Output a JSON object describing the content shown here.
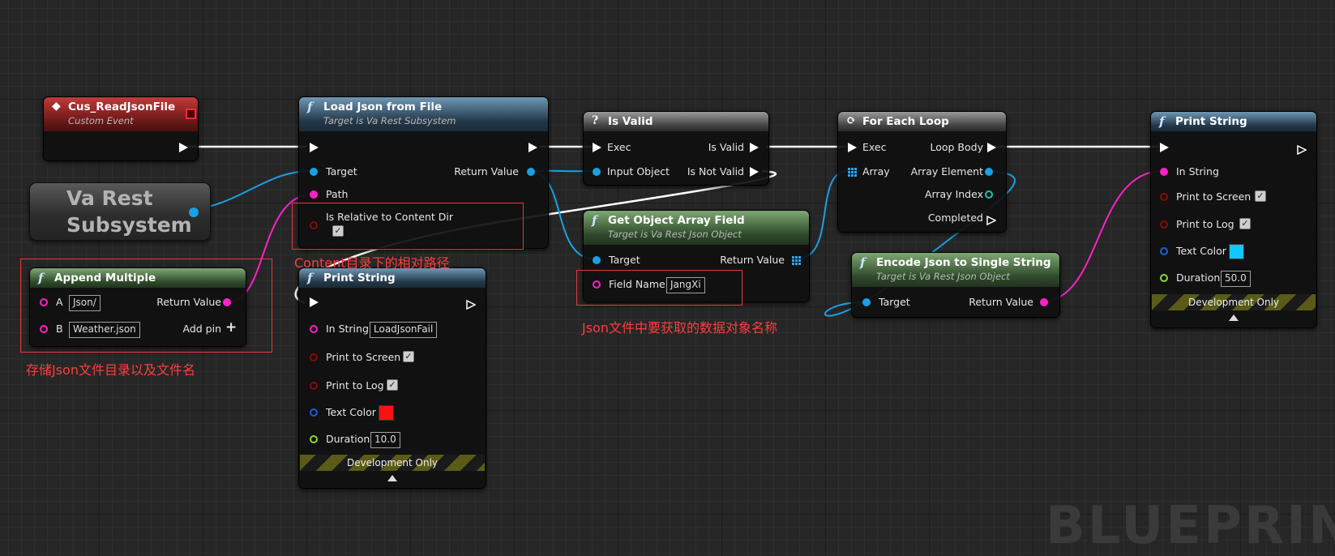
{
  "watermark": "BLUEPRINT",
  "colors": {
    "exec": "#ffffff",
    "object": "#1aa0e6",
    "string": "#ff20c8",
    "bool": "#8a0a0a",
    "struct": "#1a5fd6",
    "float": "#8ed63a",
    "annotation": "#ff3d3d",
    "print1_text_color": "#ff1010",
    "print2_text_color": "#12c8ff"
  },
  "nodes": {
    "custom_event": {
      "title": "Cus_ReadJsonFile",
      "subtitle": "Custom Event"
    },
    "subsystem_var": {
      "label": "Va Rest Subsystem"
    },
    "append_multiple": {
      "title": "Append Multiple",
      "pin_a": "A",
      "value_a": "Json/",
      "pin_b": "B",
      "value_b": "Weather.json",
      "return": "Return Value",
      "add_pin": "Add pin"
    },
    "load_json": {
      "title": "Load Json from File",
      "subtitle": "Target is Va Rest Subsystem",
      "target": "Target",
      "path": "Path",
      "relative": "Is Relative to Content Dir",
      "return": "Return Value"
    },
    "print_fail": {
      "title": "Print String",
      "in_string": "In String",
      "in_string_value": "LoadJsonFail",
      "print_screen": "Print to Screen",
      "print_log": "Print to Log",
      "text_color": "Text Color",
      "duration": "Duration",
      "duration_value": "10.0",
      "dev_only": "Development Only"
    },
    "is_valid": {
      "title": "Is Valid",
      "exec": "Exec",
      "is_valid": "Is Valid",
      "input_object": "Input Object",
      "is_not_valid": "Is Not Valid"
    },
    "get_array_field": {
      "title": "Get Object Array Field",
      "subtitle": "Target is Va Rest Json Object",
      "target": "Target",
      "return": "Return Value",
      "field_name": "Field Name",
      "field_value": "JangXi"
    },
    "for_each": {
      "title": "For Each Loop",
      "exec": "Exec",
      "loop_body": "Loop Body",
      "array": "Array",
      "array_element": "Array Element",
      "array_index": "Array Index",
      "completed": "Completed"
    },
    "encode_json": {
      "title": "Encode Json to Single String",
      "subtitle": "Target is Va Rest Json Object",
      "target": "Target",
      "return": "Return Value"
    },
    "print_string": {
      "title": "Print String",
      "in_string": "In String",
      "print_screen": "Print to Screen",
      "print_log": "Print to Log",
      "text_color": "Text Color",
      "duration": "Duration",
      "duration_value": "50.0",
      "dev_only": "Development Only"
    }
  },
  "annotations": {
    "content_dir": "Content目录下的相对路径",
    "json_object": "Json文件中要获取的数据对象名称",
    "json_path": "存储Json文件目录以及文件名"
  }
}
